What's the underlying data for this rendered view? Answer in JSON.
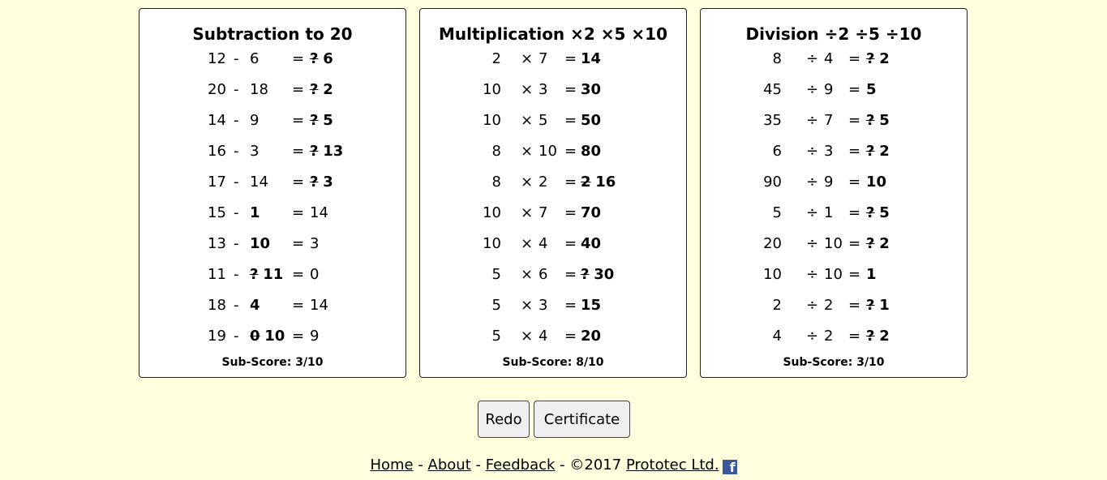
{
  "panels": [
    {
      "title": "Subtraction to 20",
      "subscore": "Sub-Score: 3/10",
      "rows": [
        {
          "a": "12",
          "op": "-",
          "b": "6",
          "eq": "=",
          "c": "",
          "wrong": "?",
          "ans": "6",
          "blank": "c"
        },
        {
          "a": "20",
          "op": "-",
          "b": "18",
          "eq": "=",
          "c": "",
          "wrong": "?",
          "ans": "2",
          "blank": "c"
        },
        {
          "a": "14",
          "op": "-",
          "b": "9",
          "eq": "=",
          "c": "",
          "wrong": "?",
          "ans": "5",
          "blank": "c"
        },
        {
          "a": "16",
          "op": "-",
          "b": "3",
          "eq": "=",
          "c": "",
          "wrong": "?",
          "ans": "13",
          "blank": "c"
        },
        {
          "a": "17",
          "op": "-",
          "b": "14",
          "eq": "=",
          "c": "",
          "wrong": "?",
          "ans": "3",
          "blank": "c"
        },
        {
          "a": "15",
          "op": "-",
          "b": "",
          "eq": "=",
          "c": "14",
          "wrong": "",
          "ans": "1",
          "blank": "b"
        },
        {
          "a": "13",
          "op": "-",
          "b": "",
          "eq": "=",
          "c": "3",
          "wrong": "",
          "ans": "10",
          "blank": "b"
        },
        {
          "a": "11",
          "op": "-",
          "b": "",
          "eq": "=",
          "c": "0",
          "wrong": "?",
          "ans": "11",
          "blank": "b"
        },
        {
          "a": "18",
          "op": "-",
          "b": "",
          "eq": "=",
          "c": "14",
          "wrong": "",
          "ans": "4",
          "blank": "b"
        },
        {
          "a": "19",
          "op": "-",
          "b": "",
          "eq": "=",
          "c": "9",
          "wrong": "0",
          "ans": "10",
          "blank": "b"
        }
      ]
    },
    {
      "title": "Multiplication ×2 ×5 ×10",
      "subscore": "Sub-Score: 8/10",
      "rows": [
        {
          "a": "2",
          "op": "×",
          "b": "7",
          "eq": "=",
          "c": "",
          "wrong": "",
          "ans": "14",
          "blank": "c"
        },
        {
          "a": "10",
          "op": "×",
          "b": "3",
          "eq": "=",
          "c": "",
          "wrong": "",
          "ans": "30",
          "blank": "c"
        },
        {
          "a": "10",
          "op": "×",
          "b": "5",
          "eq": "=",
          "c": "",
          "wrong": "",
          "ans": "50",
          "blank": "c"
        },
        {
          "a": "8",
          "op": "×",
          "b": "10",
          "eq": "=",
          "c": "",
          "wrong": "",
          "ans": "80",
          "blank": "c"
        },
        {
          "a": "8",
          "op": "×",
          "b": "2",
          "eq": "=",
          "c": "",
          "wrong": "2",
          "ans": "16",
          "blank": "c"
        },
        {
          "a": "10",
          "op": "×",
          "b": "7",
          "eq": "=",
          "c": "",
          "wrong": "",
          "ans": "70",
          "blank": "c"
        },
        {
          "a": "10",
          "op": "×",
          "b": "4",
          "eq": "=",
          "c": "",
          "wrong": "",
          "ans": "40",
          "blank": "c"
        },
        {
          "a": "5",
          "op": "×",
          "b": "6",
          "eq": "=",
          "c": "",
          "wrong": "?",
          "ans": "30",
          "blank": "c"
        },
        {
          "a": "5",
          "op": "×",
          "b": "3",
          "eq": "=",
          "c": "",
          "wrong": "",
          "ans": "15",
          "blank": "c"
        },
        {
          "a": "5",
          "op": "×",
          "b": "4",
          "eq": "=",
          "c": "",
          "wrong": "",
          "ans": "20",
          "blank": "c"
        }
      ]
    },
    {
      "title": "Division ÷2 ÷5 ÷10",
      "subscore": "Sub-Score: 3/10",
      "rows": [
        {
          "a": "8",
          "op": "÷",
          "b": "4",
          "eq": "=",
          "c": "",
          "wrong": "?",
          "ans": "2",
          "blank": "c"
        },
        {
          "a": "45",
          "op": "÷",
          "b": "9",
          "eq": "=",
          "c": "",
          "wrong": "",
          "ans": "5",
          "blank": "c"
        },
        {
          "a": "35",
          "op": "÷",
          "b": "7",
          "eq": "=",
          "c": "",
          "wrong": "?",
          "ans": "5",
          "blank": "c"
        },
        {
          "a": "6",
          "op": "÷",
          "b": "3",
          "eq": "=",
          "c": "",
          "wrong": "?",
          "ans": "2",
          "blank": "c"
        },
        {
          "a": "90",
          "op": "÷",
          "b": "9",
          "eq": "=",
          "c": "",
          "wrong": "",
          "ans": "10",
          "blank": "c"
        },
        {
          "a": "5",
          "op": "÷",
          "b": "1",
          "eq": "=",
          "c": "",
          "wrong": "?",
          "ans": "5",
          "blank": "c"
        },
        {
          "a": "20",
          "op": "÷",
          "b": "10",
          "eq": "=",
          "c": "",
          "wrong": "?",
          "ans": "2",
          "blank": "c"
        },
        {
          "a": "10",
          "op": "÷",
          "b": "10",
          "eq": "=",
          "c": "",
          "wrong": "",
          "ans": "1",
          "blank": "c"
        },
        {
          "a": "2",
          "op": "÷",
          "b": "2",
          "eq": "=",
          "c": "",
          "wrong": "?",
          "ans": "1",
          "blank": "c"
        },
        {
          "a": "4",
          "op": "÷",
          "b": "2",
          "eq": "=",
          "c": "",
          "wrong": "?",
          "ans": "2",
          "blank": "c"
        }
      ]
    }
  ],
  "buttons": {
    "redo": "Redo",
    "certificate": "Certificate"
  },
  "footer": {
    "home": "Home",
    "sep": " - ",
    "about": "About",
    "feedback": "Feedback",
    "copyright": "©2017",
    "company": "Prototec Ltd.",
    "fb_icon": "f"
  },
  "colors": {
    "background": "#ffffdd",
    "panel": "#ffffff",
    "facebook": "#3b5998"
  }
}
